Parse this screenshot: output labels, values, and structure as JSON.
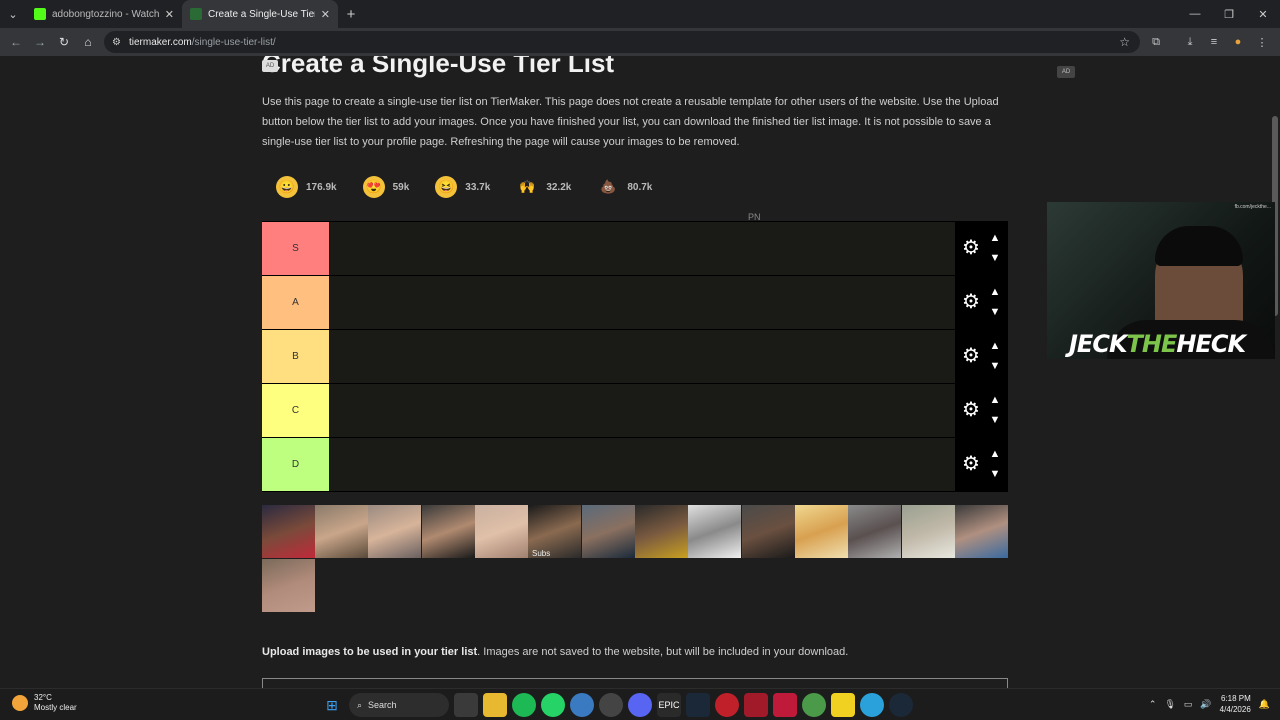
{
  "browser": {
    "tabs": [
      {
        "title": "adobongtozzino - Watch the V",
        "favicon_color": "#53fc18"
      },
      {
        "title": "Create a Single-Use Tier List (P",
        "favicon_color": "#2a6b35"
      }
    ],
    "url_host": "tiermaker.com",
    "url_path": "/single-use-tier-list/"
  },
  "page": {
    "title": "Create a Single-Use Tier List",
    "ad_label": "AD",
    "intro": "Use this page to create a single-use tier list on TierMaker. This page does not create a reusable template for other users of the website. Use the Upload button below the tier list to add your images. Once you have finished your list, you can download the finished tier list image. It is not possible to save a single-use tier list to your profile page. Refreshing the page will cause your images to be removed.",
    "pn_label": "PN",
    "reactions": [
      {
        "icon": "grin-emoji-icon",
        "count": "176.9k",
        "color": "#f3c13a"
      },
      {
        "icon": "heart-eyes-emoji-icon",
        "count": "59k",
        "color": "#f3c13a"
      },
      {
        "icon": "laughing-emoji-icon",
        "count": "33.7k",
        "color": "#f3c13a"
      },
      {
        "icon": "raised-hands-emoji-icon",
        "count": "32.2k",
        "color": "#f3c13a"
      },
      {
        "icon": "poop-emoji-icon",
        "count": "80.7k",
        "color": "#b4567a"
      }
    ],
    "tiers": [
      {
        "label": "S",
        "color": "#ff7f7f"
      },
      {
        "label": "A",
        "color": "#ffbf7f"
      },
      {
        "label": "B",
        "color": "#ffdf7f"
      },
      {
        "label": "C",
        "color": "#ffff7f"
      },
      {
        "label": "D",
        "color": "#bfff7f"
      }
    ],
    "gallery_count": 15,
    "gallery_caption": "Subs",
    "upload_bold": "Upload images to be used in your tier list",
    "upload_rest": ". Images are not saved to the website, but will be included in your download."
  },
  "webcam": {
    "logo_a": "JECK",
    "logo_b": "THE",
    "logo_c": "HECK",
    "small": "fb.com/jeckthe..."
  },
  "taskbar": {
    "temp": "32°C",
    "weather": "Mostly clear",
    "search": "Search",
    "time": "6:18 PM",
    "date": "4/4/2026"
  }
}
